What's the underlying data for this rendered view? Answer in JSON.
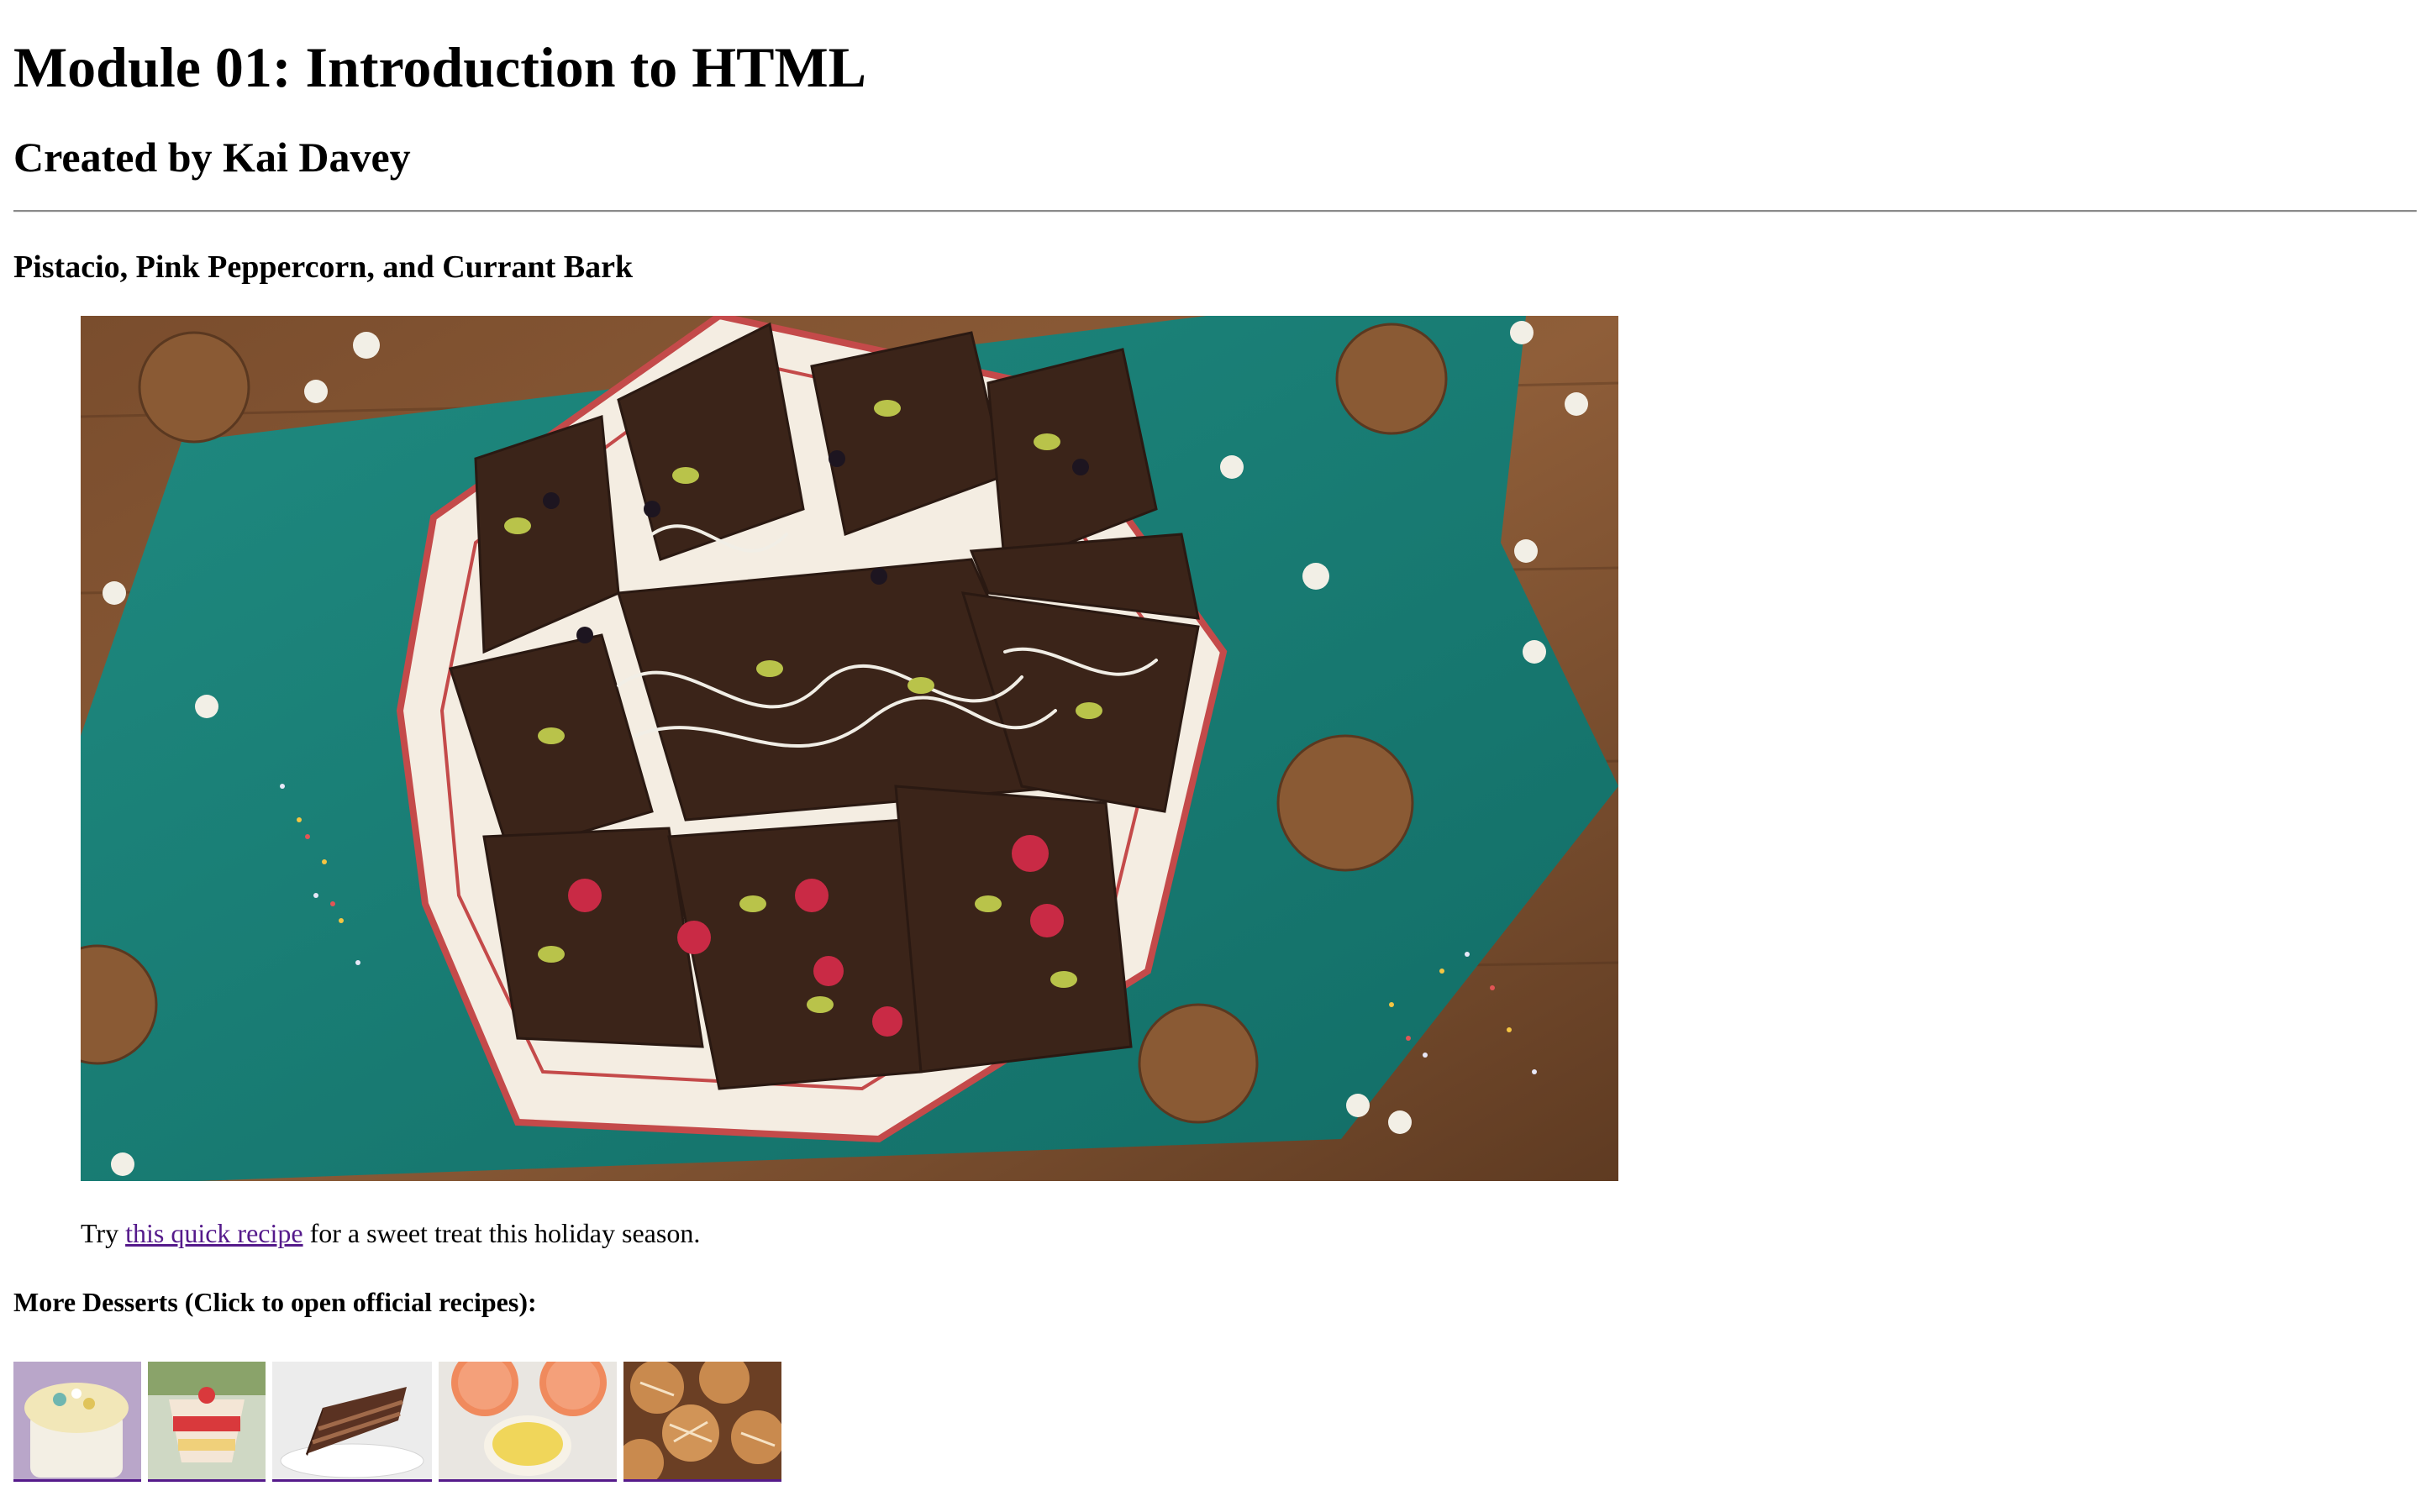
{
  "page": {
    "title": "Module 01: Introduction to HTML",
    "author_line": "Created by Kai Davey"
  },
  "recipe": {
    "heading": "Pistacio, Pink Peppercorn, and Currant Bark",
    "image_alt": "Chocolate bark with pistachios, pink peppercorns and currants on a plate",
    "caption_before": "Try ",
    "caption_link": "this quick recipe",
    "caption_after": " for a sweet treat this holiday season."
  },
  "more": {
    "heading": "More Desserts (Click to open official recipes):",
    "thumbnails": [
      {
        "alt": "Popcorn snack mix dessert"
      },
      {
        "alt": "Strawberry trifle dessert"
      },
      {
        "alt": "Chocolate layer cake slice"
      },
      {
        "alt": "Grapefruit custard dessert"
      },
      {
        "alt": "Caramel drizzled cookies"
      }
    ]
  },
  "colors": {
    "link_visited": "#551a8b",
    "divider": "#8a8a8a"
  }
}
